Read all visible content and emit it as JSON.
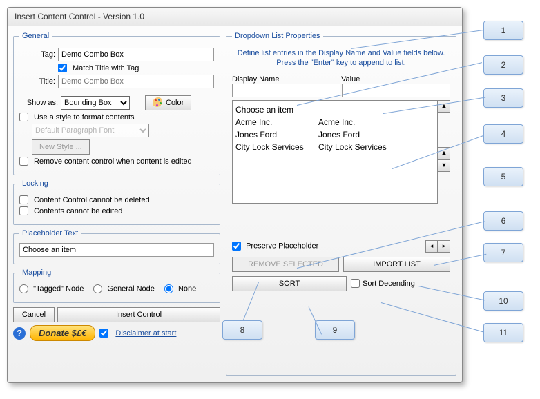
{
  "window": {
    "title": "Insert Content Control - Version 1.0"
  },
  "general": {
    "legend": "General",
    "tag_label": "Tag:",
    "tag_value": "Demo Combo Box",
    "match_title_label": "Match Title with Tag",
    "match_title_checked": true,
    "title_label": "Title:",
    "title_placeholder": "Demo Combo Box",
    "show_as_label": "Show as:",
    "show_as_value": "Bounding Box",
    "color_label": "Color",
    "use_style_label": "Use a style to format contents",
    "use_style_checked": false,
    "style_value": "Default Paragraph Font",
    "new_style_label": "New Style ...",
    "remove_on_edit_label": "Remove content control when content is edited",
    "remove_on_edit_checked": false
  },
  "locking": {
    "legend": "Locking",
    "cannot_delete_label": "Content Control cannot be deleted",
    "cannot_delete_checked": false,
    "cannot_edit_label": "Contents cannot be edited",
    "cannot_edit_checked": false
  },
  "placeholder": {
    "legend": "Placeholder Text",
    "value": "Choose an item"
  },
  "mapping": {
    "legend": "Mapping",
    "tagged_label": "\"Tagged\" Node",
    "general_label": "General Node",
    "none_label": "None",
    "selected": "none"
  },
  "dropdown": {
    "legend": "Dropdown List Properties",
    "help_text": "Define list entries in the Display Name and Value fields below. Press the \"Enter\" key to append to list.",
    "display_name_header": "Display Name",
    "value_header": "Value",
    "items": [
      {
        "display": "Choose an item",
        "value": ""
      },
      {
        "display": "Acme Inc.",
        "value": "Acme Inc."
      },
      {
        "display": "Jones Ford",
        "value": "Jones Ford"
      },
      {
        "display": "City Lock Services",
        "value": "City Lock Services"
      }
    ],
    "preserve_label": "Preserve Placeholder",
    "preserve_checked": true,
    "remove_selected_label": "REMOVE SELECTED",
    "import_list_label": "IMPORT LIST",
    "sort_label": "SORT",
    "sort_desc_label": "Sort Decending",
    "sort_desc_checked": false
  },
  "buttons": {
    "cancel": "Cancel",
    "insert": "Insert Control",
    "donate": "Donate $£€",
    "disclaimer_label": "Disclaimer at start",
    "disclaimer_checked": true
  },
  "callouts": [
    "1",
    "2",
    "3",
    "4",
    "5",
    "6",
    "7",
    "8",
    "9",
    "10",
    "11"
  ]
}
